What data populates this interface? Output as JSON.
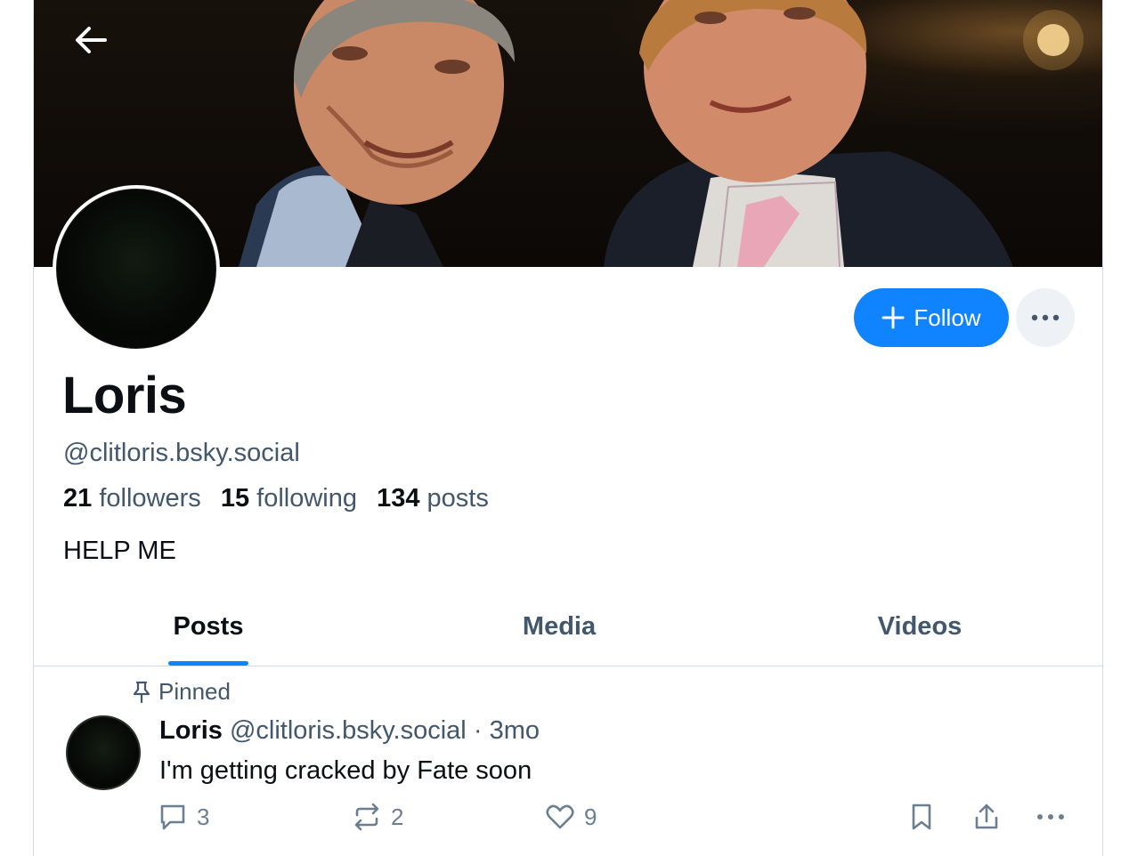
{
  "profile": {
    "display_name": "Loris",
    "handle": "@clitloris.bsky.social",
    "followers_count": "21",
    "followers_label": "followers",
    "following_count": "15",
    "following_label": "following",
    "posts_count": "134",
    "posts_label": "posts",
    "bio": "HELP ME"
  },
  "actions": {
    "follow_label": "Follow"
  },
  "tabs": [
    {
      "label": "Posts",
      "active": true
    },
    {
      "label": "Media",
      "active": false
    },
    {
      "label": "Videos",
      "active": false
    }
  ],
  "post": {
    "pinned_label": "Pinned",
    "author_name": "Loris",
    "author_handle": "@clitloris.bsky.social",
    "separator": "·",
    "time": "3mo",
    "text": "I'm getting cracked by Fate soon",
    "reply_count": "3",
    "repost_count": "2",
    "like_count": "9"
  },
  "icons": {
    "back": "arrow-left-icon",
    "more": "ellipsis-icon",
    "follow_plus": "plus-icon",
    "pin": "pin-icon",
    "reply": "speech-bubble-icon",
    "repost": "repost-icon",
    "like": "heart-icon",
    "bookmark": "bookmark-icon",
    "share": "share-icon"
  },
  "colors": {
    "accent": "#1083fe",
    "muted_text": "#42576c",
    "action_icon": "#6b7f93"
  }
}
